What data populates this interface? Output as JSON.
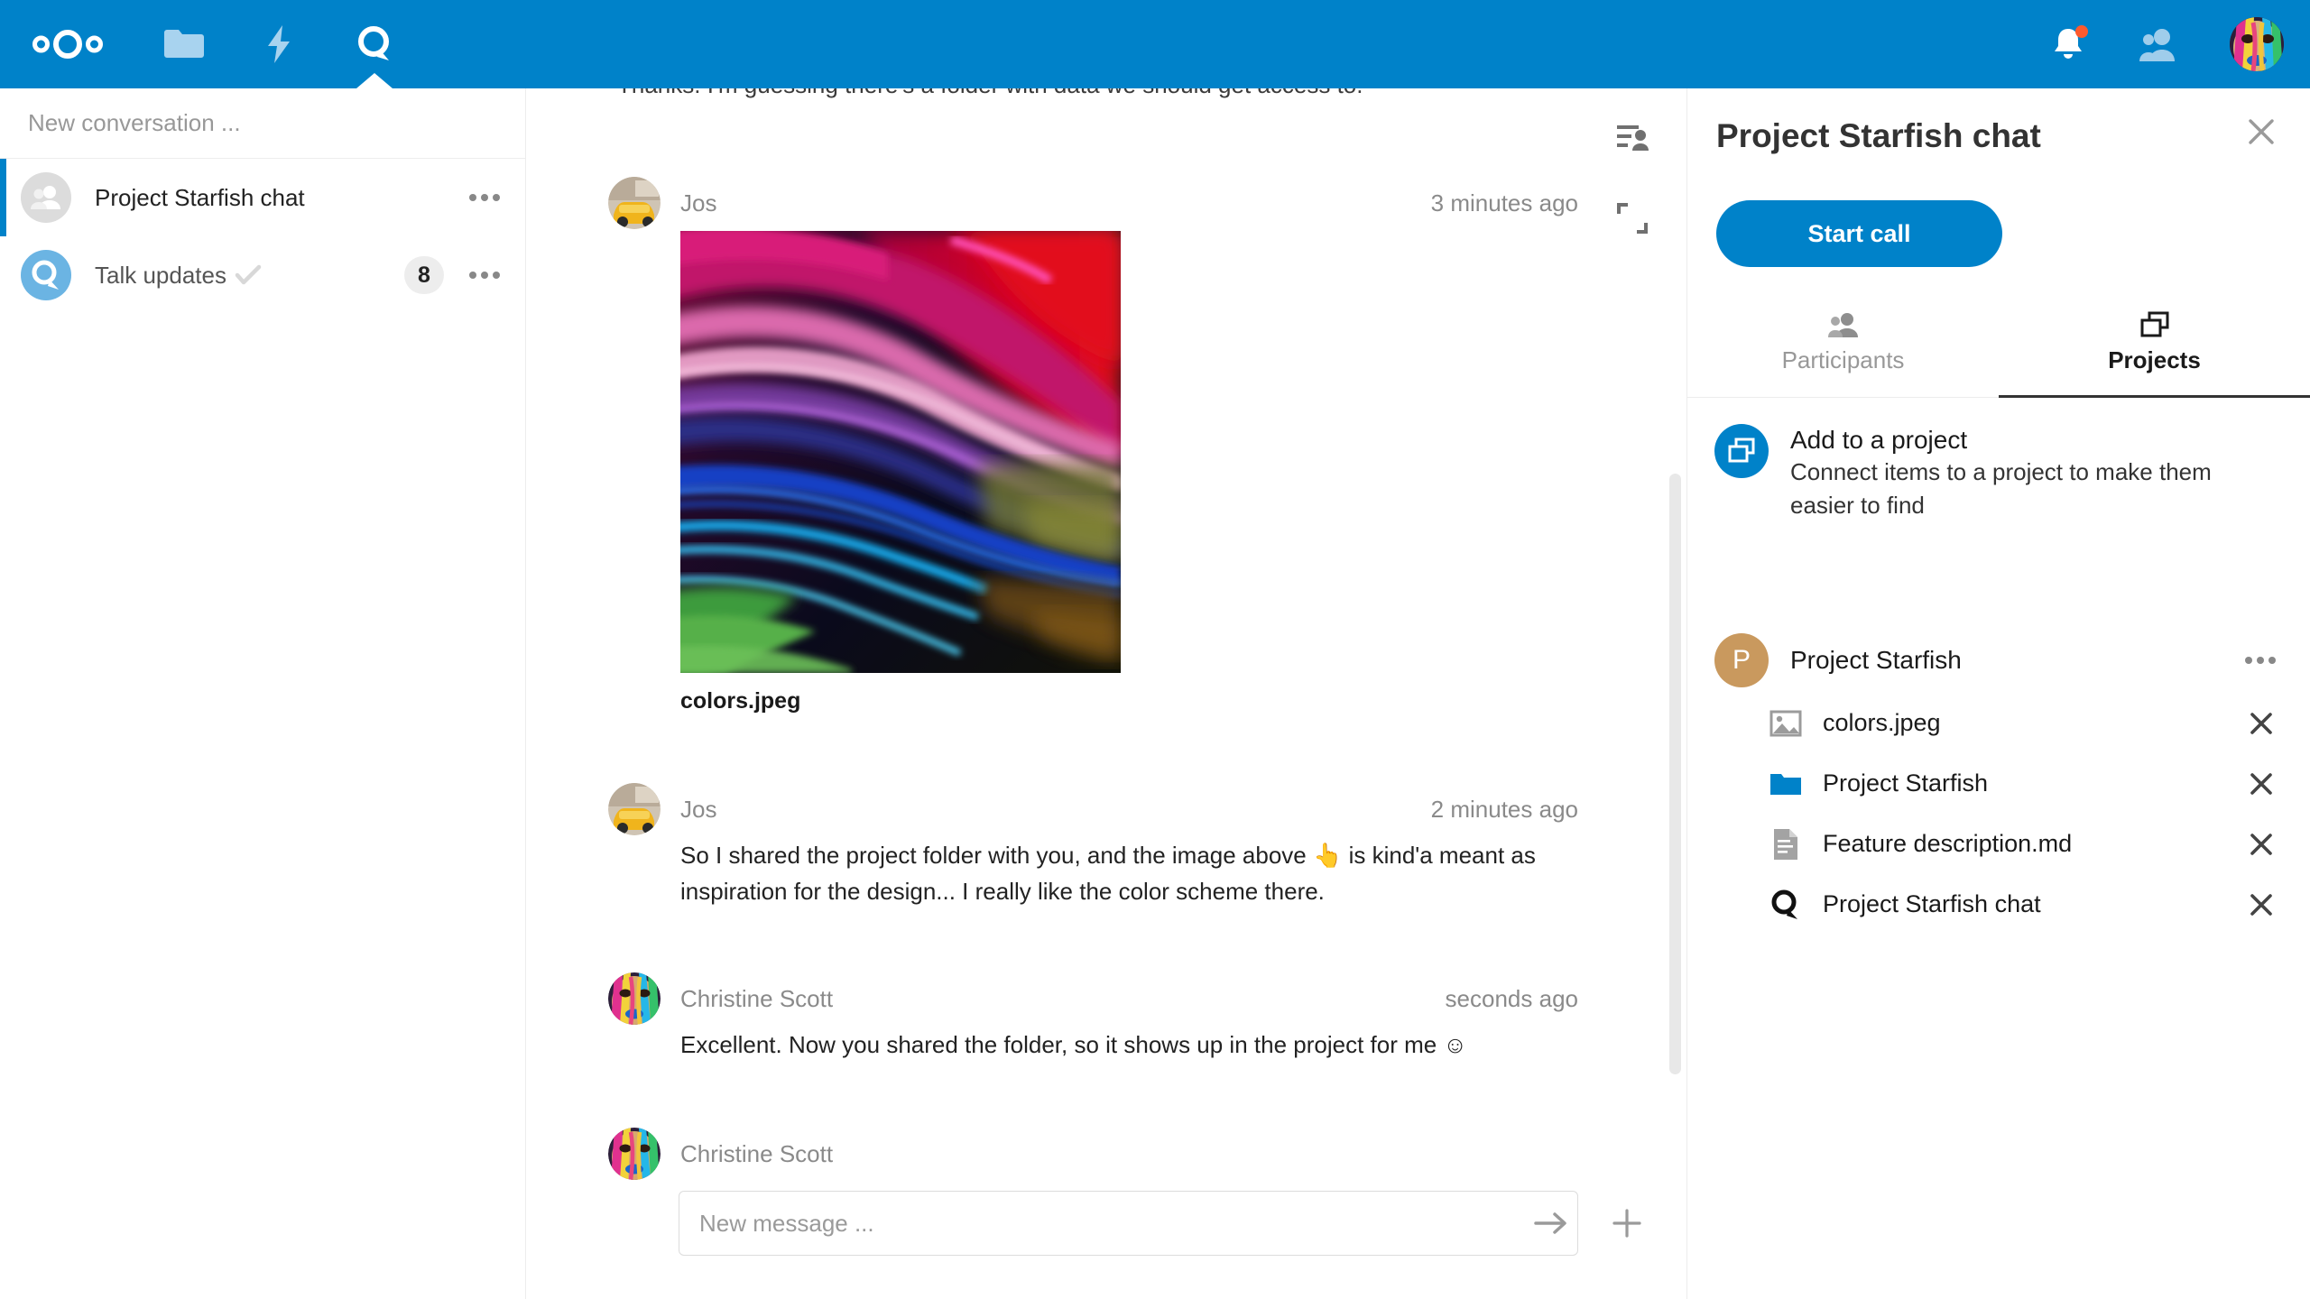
{
  "header": {
    "logo": "nextcloud-logo",
    "apps": [
      {
        "name": "files",
        "icon": "folder-icon",
        "active": false
      },
      {
        "name": "activity",
        "icon": "lightning-icon",
        "active": false
      },
      {
        "name": "talk",
        "icon": "talk-icon",
        "active": true
      }
    ],
    "right": [
      {
        "name": "notifications",
        "icon": "bell-icon",
        "badge": true
      },
      {
        "name": "contacts",
        "icon": "contacts-icon",
        "badge": false
      }
    ],
    "user_avatar_label": "Christine Scott",
    "brand_color": "#0082c9"
  },
  "sidebar": {
    "search_placeholder": "New conversation ...",
    "conversations": [
      {
        "name": "Project Starfish chat",
        "avatar_type": "group",
        "selected": true,
        "badge": "",
        "check": false
      },
      {
        "name": "Talk updates",
        "avatar_type": "talk",
        "selected": false,
        "badge": "8",
        "check": true
      }
    ]
  },
  "chat": {
    "cutoff_message": "Thanks. I'm guessing there's a folder with data we should get access to.",
    "messages": [
      {
        "author": "Jos",
        "time": "3 minutes ago",
        "avatar": "yellow-car-photo",
        "attachment_name": "colors.jpeg",
        "text": ""
      },
      {
        "author": "Jos",
        "time": "2 minutes ago",
        "avatar": "yellow-car-photo",
        "attachment_name": "",
        "text": "So I shared the project folder with you, and the image above 👆 is kind'a meant as inspiration for the design... I really like the color scheme there."
      },
      {
        "author": "Christine Scott",
        "time": "seconds ago",
        "avatar": "face-paint-photo",
        "attachment_name": "",
        "text": "Excellent. Now you shared the folder, so it shows up in the project for me ☺"
      },
      {
        "author": "Christine Scott",
        "time": "",
        "avatar": "face-paint-photo",
        "attachment_name": "",
        "text": ""
      }
    ],
    "input_placeholder": "New message ...",
    "send_icon": "arrow-right-icon",
    "attach_icon": "plus-icon",
    "top_icons": [
      {
        "name": "participants-details-icon"
      },
      {
        "name": "expand-icon"
      }
    ]
  },
  "right_sidebar": {
    "title": "Project Starfish chat",
    "close_icon": "close-icon",
    "start_call_label": "Start call",
    "tabs": [
      {
        "label": "Participants",
        "icon": "participants-icon",
        "active": false
      },
      {
        "label": "Projects",
        "icon": "projects-icon",
        "active": true
      }
    ],
    "add_to_project": {
      "title": "Add to a project",
      "subtitle": "Connect items to a project to make them easier to find",
      "icon": "projects-icon",
      "icon_color": "#0082c9"
    },
    "project": {
      "name": "Project Starfish",
      "initial": "P",
      "avatar_color": "#c9995e",
      "menu_icon": "more-icon"
    },
    "project_items": [
      {
        "name": "colors.jpeg",
        "icon": "image-file-icon",
        "remove_icon": "close-icon"
      },
      {
        "name": "Project Starfish",
        "icon": "folder-icon",
        "remove_icon": "close-icon"
      },
      {
        "name": "Feature description.md",
        "icon": "text-file-icon",
        "remove_icon": "close-icon"
      },
      {
        "name": "Project Starfish chat",
        "icon": "talk-icon",
        "remove_icon": "close-icon"
      }
    ]
  },
  "colors": {
    "brand": "#0082c9",
    "folder_blue": "#0082c9",
    "notification_dot": "#ff5a2d",
    "badge_bg": "#ededed",
    "project_avatar": "#c9995e"
  }
}
